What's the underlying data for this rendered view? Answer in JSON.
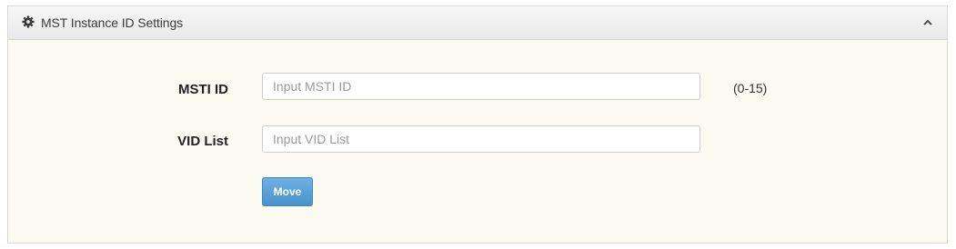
{
  "panel": {
    "title": "MST Instance ID Settings",
    "icon": "gear-icon",
    "collapse_icon": "chevron-up-icon"
  },
  "form": {
    "msti_id": {
      "label": "MSTI ID",
      "placeholder": "Input MSTI ID",
      "value": "",
      "range": "(0-15)"
    },
    "vid_list": {
      "label": "VID List",
      "placeholder": "Input VID List",
      "value": ""
    },
    "move_label": "Move"
  },
  "colors": {
    "panel_background": "#fbfaf0",
    "header_background": "#eeeeee",
    "button_blue": "#5aa2d8"
  }
}
